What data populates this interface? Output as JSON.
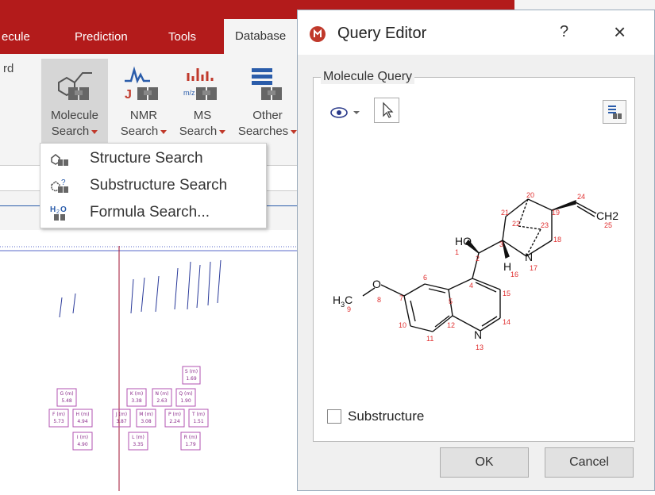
{
  "ribbon": {
    "tabs": [
      "ecule",
      "Prediction",
      "Tools",
      "Database"
    ],
    "partial_left": "rd",
    "buttons": [
      {
        "line1": "Molecule",
        "line2": "Search",
        "icon": "molecule-search-icon"
      },
      {
        "line1": "NMR",
        "line2": "Search",
        "icon": "nmr-search-icon"
      },
      {
        "line1": "MS",
        "line2": "Search",
        "icon": "ms-search-icon"
      },
      {
        "line1": "Other",
        "line2": "Searches",
        "icon": "other-searches-icon"
      }
    ]
  },
  "dropdown": {
    "items": [
      {
        "label": "Structure Search",
        "icon": "structure-search-icon"
      },
      {
        "label": "Substructure Search",
        "icon": "substructure-search-icon"
      },
      {
        "label": "Formula Search...",
        "icon": "formula-search-icon"
      }
    ]
  },
  "spectrum": {
    "peaks": [
      {
        "label": "S (m)",
        "val": "1.69"
      },
      {
        "label": "G (m)",
        "val": "5.48"
      },
      {
        "label": "K (m)",
        "val": "3.38"
      },
      {
        "label": "N (m)",
        "val": "2.63"
      },
      {
        "label": "Q (m)",
        "val": "1.90"
      },
      {
        "label": "F (m)",
        "val": "5.73"
      },
      {
        "label": "H (m)",
        "val": "4.94"
      },
      {
        "label": "J (m)",
        "val": "3.87"
      },
      {
        "label": "M (m)",
        "val": "3.08"
      },
      {
        "label": "P (m)",
        "val": "2.24"
      },
      {
        "label": "T (m)",
        "val": "1.51"
      },
      {
        "label": "I (m)",
        "val": "4.90"
      },
      {
        "label": "L (m)",
        "val": "3.35"
      },
      {
        "label": "R (m)",
        "val": "1.79"
      }
    ]
  },
  "dialog": {
    "title": "Query Editor",
    "help": "?",
    "close": "×",
    "group_label": "Molecule Query",
    "checkbox_label": "Substructure",
    "checkbox_checked": false,
    "ok_label": "OK",
    "cancel_label": "Cancel"
  },
  "molecule": {
    "atoms": [
      "HO",
      "H",
      "N",
      "N",
      "O",
      "CH2"
    ],
    "numbers": [
      "1",
      "2",
      "3",
      "4",
      "5",
      "6",
      "7",
      "8",
      "9",
      "10",
      "11",
      "12",
      "13",
      "14",
      "15",
      "16",
      "17",
      "18",
      "19",
      "20",
      "21",
      "22",
      "23",
      "24",
      "25"
    ]
  },
  "colors": {
    "brand_red": "#b31b1b",
    "atom_number": "#e03030"
  }
}
